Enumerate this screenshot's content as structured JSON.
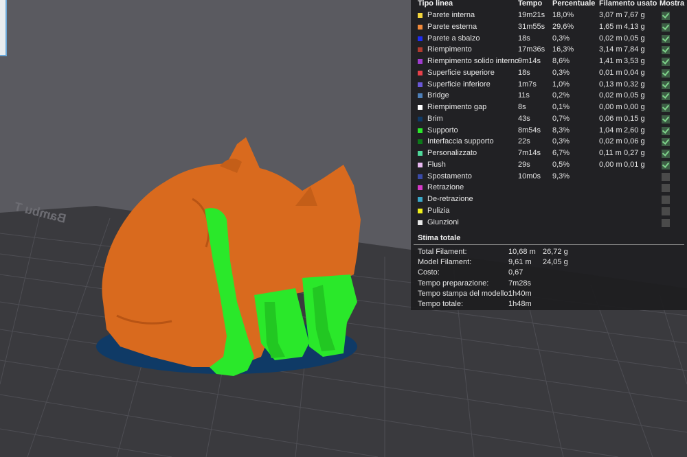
{
  "legend": {
    "headers": {
      "type": "Tipo linea",
      "time": "Tempo",
      "percent": "Percentuale",
      "filament": "Filamento usato",
      "show": "Mostra"
    },
    "rows": [
      {
        "name": "Parete interna",
        "color": "#f2d43c",
        "time": "19m21s",
        "pct": "18,0%",
        "len": "3,07 m",
        "wt": "7,67 g",
        "show": true
      },
      {
        "name": "Parete esterna",
        "color": "#f28a3a",
        "time": "31m55s",
        "pct": "29,6%",
        "len": "1,65 m",
        "wt": "4,13 g",
        "show": true
      },
      {
        "name": "Parete a sbalzo",
        "color": "#1f2cf0",
        "time": "18s",
        "pct": "0,3%",
        "len": "0,02 m",
        "wt": "0,05 g",
        "show": true
      },
      {
        "name": "Riempimento",
        "color": "#b03a2e",
        "time": "17m36s",
        "pct": "16,3%",
        "len": "3,14 m",
        "wt": "7,84 g",
        "show": true
      },
      {
        "name": "Riempimento solido interno",
        "color": "#a03ccf",
        "time": "9m14s",
        "pct": "8,6%",
        "len": "1,41 m",
        "wt": "3,53 g",
        "show": true
      },
      {
        "name": "Superficie superiore",
        "color": "#e8404a",
        "time": "18s",
        "pct": "0,3%",
        "len": "0,01 m",
        "wt": "0,04 g",
        "show": true
      },
      {
        "name": "Superficie inferiore",
        "color": "#6a58d8",
        "time": "1m7s",
        "pct": "1,0%",
        "len": "0,13 m",
        "wt": "0,32 g",
        "show": true
      },
      {
        "name": "Bridge",
        "color": "#4d7fb8",
        "time": "11s",
        "pct": "0,2%",
        "len": "0,02 m",
        "wt": "0,05 g",
        "show": true
      },
      {
        "name": "Riempimento gap",
        "color": "#ffffff",
        "time": "8s",
        "pct": "0,1%",
        "len": "0,00 m",
        "wt": "0,00 g",
        "show": true
      },
      {
        "name": "Brim",
        "color": "#0f3a66",
        "time": "43s",
        "pct": "0,7%",
        "len": "0,06 m",
        "wt": "0,15 g",
        "show": true
      },
      {
        "name": "Supporto",
        "color": "#2ae82a",
        "time": "8m54s",
        "pct": "8,3%",
        "len": "1,04 m",
        "wt": "2,60 g",
        "show": true
      },
      {
        "name": "Interfaccia supporto",
        "color": "#0c7a18",
        "time": "22s",
        "pct": "0,3%",
        "len": "0,02 m",
        "wt": "0,06 g",
        "show": true
      },
      {
        "name": "Personalizzato",
        "color": "#4fd89a",
        "time": "7m14s",
        "pct": "6,7%",
        "len": "0,11 m",
        "wt": "0,27 g",
        "show": true
      },
      {
        "name": "Flush",
        "color": "#e8b8f0",
        "time": "29s",
        "pct": "0,5%",
        "len": "0,00 m",
        "wt": "0,01 g",
        "show": true
      },
      {
        "name": "Spostamento",
        "color": "#3a4aa8",
        "time": "10m0s",
        "pct": "9,3%",
        "len": "",
        "wt": "",
        "show": false
      },
      {
        "name": "Retrazione",
        "color": "#d63ac8",
        "time": "",
        "pct": "",
        "len": "",
        "wt": "",
        "show": false
      },
      {
        "name": "De-retrazione",
        "color": "#3aa8c8",
        "time": "",
        "pct": "",
        "len": "",
        "wt": "",
        "show": false
      },
      {
        "name": "Pulizia",
        "color": "#f0f01a",
        "time": "",
        "pct": "",
        "len": "",
        "wt": "",
        "show": false
      },
      {
        "name": "Giunzioni",
        "color": "#e8e8e8",
        "time": "",
        "pct": "",
        "len": "",
        "wt": "",
        "show": false
      }
    ]
  },
  "summary": {
    "title": "Stima totale",
    "items": [
      {
        "label": "Total Filament:",
        "v1": "10,68 m",
        "v2": "26,72 g"
      },
      {
        "label": "Model Filament:",
        "v1": "9,61 m",
        "v2": "24,05 g"
      },
      {
        "label": "Costo:",
        "v1": "0,67",
        "v2": ""
      },
      {
        "label": "Tempo preparazione:",
        "v1": "7m28s",
        "v2": ""
      },
      {
        "label": "Tempo stampa del modello:",
        "v1": "1h40m",
        "v2": ""
      },
      {
        "label": "Tempo totale:",
        "v1": "1h48m",
        "v2": ""
      }
    ]
  },
  "viewport": {
    "plate_label": "Bambu T",
    "colors": {
      "background": "#5a5a60",
      "plate": "#3a3a3e",
      "grid": "#4e4e54",
      "model": "#d96a1e",
      "support": "#2ae82a",
      "brim": "#0f3a66"
    }
  }
}
